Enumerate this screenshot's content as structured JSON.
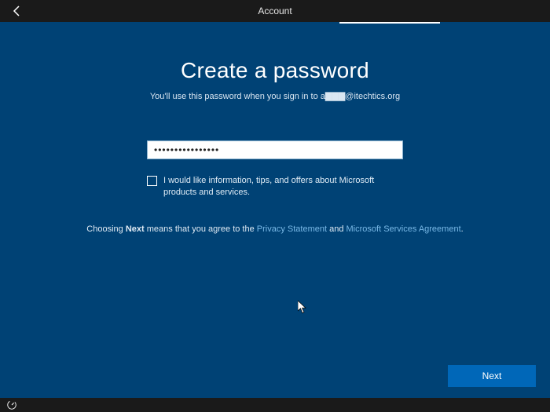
{
  "titlebar": {
    "title": "Account"
  },
  "main": {
    "headline": "Create a password",
    "subtitle_prefix": "You'll use this password when you sign in to ",
    "subtitle_email_obscured": "a▇▇▇",
    "subtitle_email_domain": "@itechtics.org",
    "password_value": "••••••••••••••••",
    "checkbox_label": "I would like information, tips, and offers about Microsoft products and services.",
    "checkbox_checked": false,
    "agreement_prefix": "Choosing ",
    "agreement_bold": "Next",
    "agreement_mid1": " means that you agree to the ",
    "agreement_link1": "Privacy Statement",
    "agreement_mid2": " and ",
    "agreement_link2": "Microsoft Services Agreement",
    "agreement_suffix": "."
  },
  "buttons": {
    "next": "Next"
  }
}
